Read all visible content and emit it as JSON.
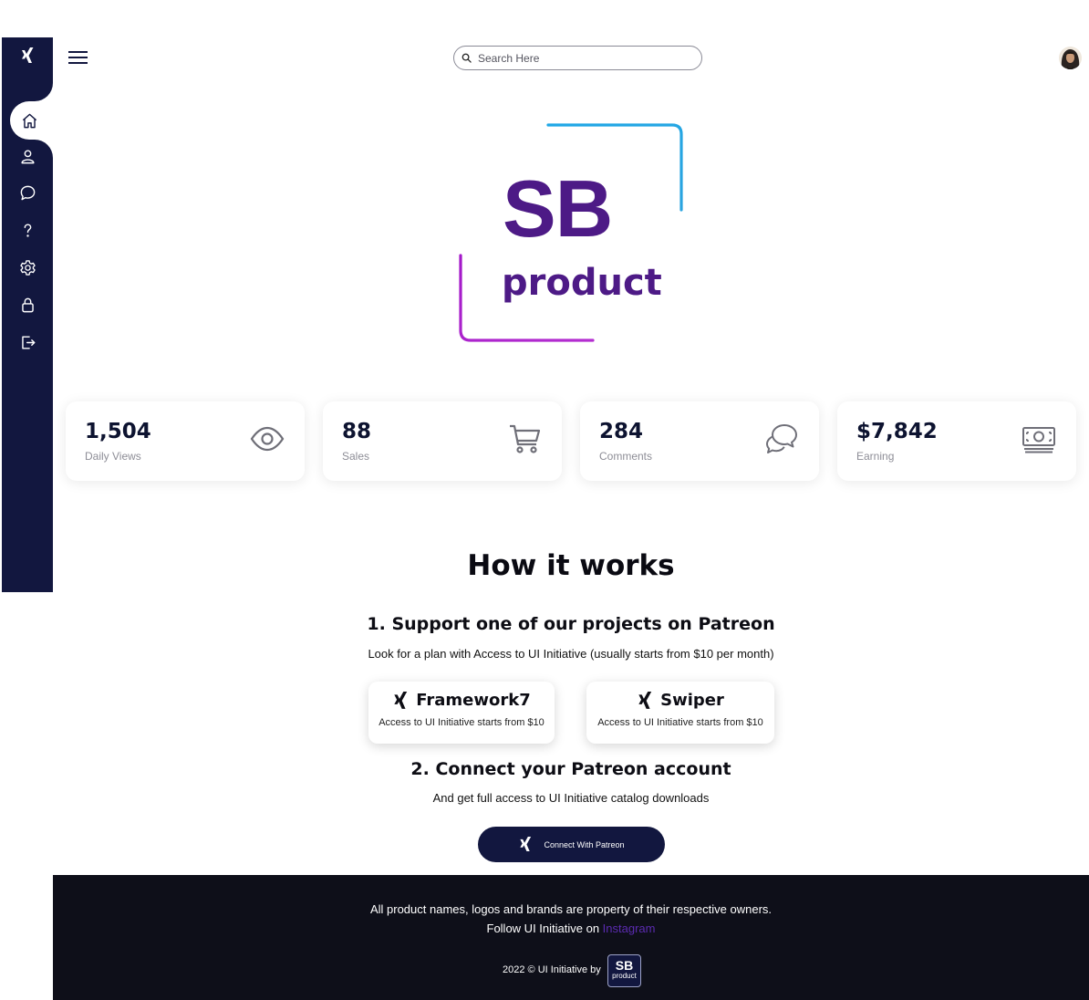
{
  "sidebar": {
    "logo_icon": "xing-logo-icon",
    "items": [
      {
        "icon": "home-icon",
        "active": true
      },
      {
        "icon": "user-icon"
      },
      {
        "icon": "chat-icon"
      },
      {
        "icon": "help-icon"
      },
      {
        "icon": "settings-icon"
      },
      {
        "icon": "lock-icon"
      },
      {
        "icon": "logout-icon"
      }
    ],
    "colors": {
      "background": "#12173f",
      "active_background": "#ffffff"
    }
  },
  "header": {
    "menu_icon": "hamburger-icon",
    "search": {
      "placeholder": "Search Here",
      "value": ""
    },
    "avatar_icon": "avatar"
  },
  "hero": {
    "logo_text": "SB",
    "logo_subtext": "product",
    "colors": {
      "text": "#4d1a86",
      "frame_top": "#2aa4e0",
      "frame_bottom": "#a91fc4"
    }
  },
  "stats": [
    {
      "value": "1,504",
      "label": "Daily Views",
      "icon": "eye-icon"
    },
    {
      "value": "88",
      "label": "Sales",
      "icon": "cart-icon"
    },
    {
      "value": "284",
      "label": "Comments",
      "icon": "comments-icon"
    },
    {
      "value": "$7,842",
      "label": "Earning",
      "icon": "money-icon"
    }
  ],
  "how": {
    "title": "How it works",
    "step1": {
      "title": "1. Support one of our projects on Patreon",
      "text": "Look for a plan with Access to UI Initiative (usually starts from $10 per month)"
    },
    "projects": [
      {
        "name": "Framework7",
        "desc": "Access to UI Initiative starts from $10",
        "icon": "xing-logo-icon"
      },
      {
        "name": "Swiper",
        "desc": "Access to UI Initiative starts from $10",
        "icon": "xing-logo-icon"
      }
    ],
    "step2": {
      "title": "2. Connect your Patreon account",
      "text": "And get full access to UI Initiative catalog downloads"
    },
    "button": {
      "label": "Connect With Patreon",
      "icon": "xing-logo-icon"
    }
  },
  "footer": {
    "line1": "All product names, logos and brands are property of their respective owners.",
    "line2_prefix": "Follow UI Initiative on ",
    "line2_link": "Instagram",
    "credit": "2022 © UI Initiative by",
    "logo_text": "SB",
    "logo_subtext": "product",
    "colors": {
      "background": "#0e0f19",
      "link": "#5b2bb0"
    }
  }
}
